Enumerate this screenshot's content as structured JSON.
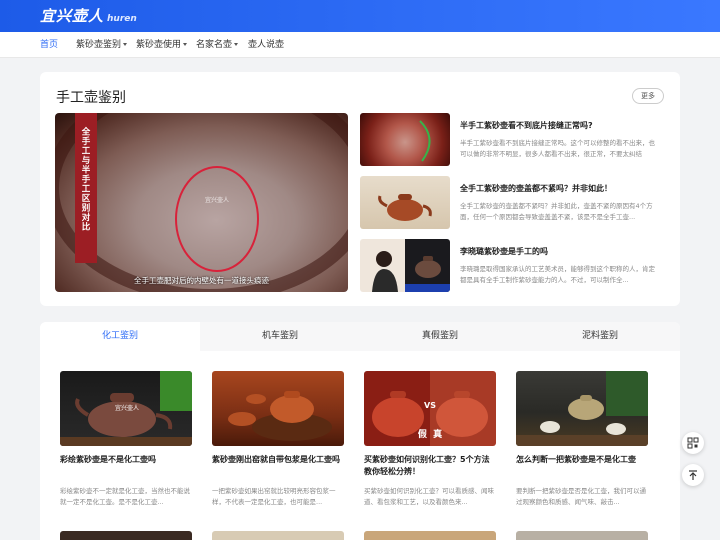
{
  "site": {
    "logo_cn": "宜兴壶人",
    "logo_en": "huren"
  },
  "nav": {
    "items": [
      {
        "label": "首页",
        "dropdown": false,
        "active": true
      },
      {
        "label": "紫砂壶鉴别",
        "dropdown": true,
        "active": false
      },
      {
        "label": "紫砂壶使用",
        "dropdown": true,
        "active": false
      },
      {
        "label": "名家名壶",
        "dropdown": true,
        "active": false
      },
      {
        "label": "壶人说壶",
        "dropdown": false,
        "active": false
      }
    ]
  },
  "section1": {
    "title": "手工壶鉴别",
    "more": "更多",
    "hero": {
      "ribbon": "全手工与半手工区别对比",
      "watermark": "宜兴壶人",
      "caption": "全手工壶肥对后的内壁处有一道接头痕迹"
    },
    "side_items": [
      {
        "title": "半手工紫砂壶看不到底片接缝正常吗?",
        "desc": "半手工紫砂壶看不到底片接缝正常吗。这个可以修整的看不出来，也可以做的非常不明显，很多人都看不出来，很正常，不要太纠结"
      },
      {
        "title": "全手工紫砂壶的壶盖都不紧吗？并非如此！",
        "desc": "全手工紫砂壶的壶盖都不紧吗？并非如此，壶盖不紧的原因有4个方面，任何一个原因都会导致壶盖盖不紧，该是不是全手工壶..."
      },
      {
        "title": "李晓璐紫砂壶是手工的吗",
        "desc": "李晓璐是取得国家承认的工艺美术员，能够得到这个职称的人，肯定都是具有全手工制作紫砂壶能力的人。不过，可以制作全..."
      }
    ]
  },
  "section2": {
    "tabs": [
      {
        "label": "化工鉴别",
        "active": true
      },
      {
        "label": "机车鉴别",
        "active": false
      },
      {
        "label": "真假鉴别",
        "active": false
      },
      {
        "label": "泥料鉴别",
        "active": false
      }
    ],
    "items": [
      {
        "title": "彩绘紫砂壶是不是化工壶吗",
        "desc": "彩绘紫砂壶不一定就是化工壶，当然也不能说就一定不是化工壶。是不是化工壶...",
        "watermark": "宜兴壶人"
      },
      {
        "title": "紫砂壶刚出窑就自带包浆是化工壶吗",
        "desc": "一把紫砂壶如果出窑就比较明亮形容包浆一样，不代表一定是化工壶，也可能是...",
        "watermark": ""
      },
      {
        "title": "买紫砂壶如何识别化工壶？5个方法教你轻松分辨！",
        "desc": "买紫砂壶如何识别化工壶？可以看质感、闻味道、看包浆和工艺，以及看颜色来...",
        "watermark": "VS",
        "overlay": "假  真"
      },
      {
        "title": "怎么判断一把紫砂壶是不是化工壶",
        "desc": "要判断一把紫砂壶是否是化工壶，我们可以通过观察颜色和质感、闻气味、敲击...",
        "watermark": ""
      }
    ]
  },
  "float_buttons": {
    "qr": "qr-code-icon",
    "top": "back-to-top-icon"
  }
}
